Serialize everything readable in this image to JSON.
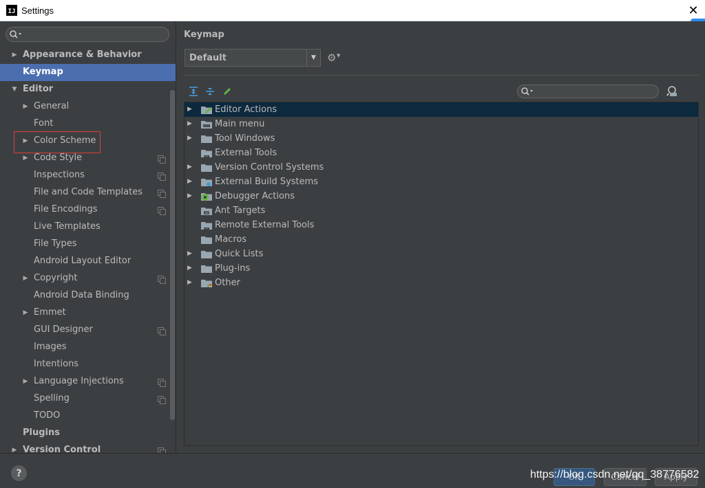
{
  "window": {
    "title": "Settings",
    "app_icon_text": "IJ"
  },
  "sidebar": {
    "search_placeholder": "",
    "items": [
      {
        "label": "Appearance & Behavior",
        "level": 0,
        "arrow": "right",
        "bold": true
      },
      {
        "label": "Keymap",
        "level": 0,
        "arrow": "",
        "bold": true,
        "selected": true
      },
      {
        "label": "Editor",
        "level": 0,
        "arrow": "down",
        "bold": true
      },
      {
        "label": "General",
        "level": 1,
        "arrow": "right"
      },
      {
        "label": "Font",
        "level": 1,
        "arrow": ""
      },
      {
        "label": "Color Scheme",
        "level": 1,
        "arrow": "right",
        "highlighted": true
      },
      {
        "label": "Code Style",
        "level": 1,
        "arrow": "right",
        "project": true
      },
      {
        "label": "Inspections",
        "level": 1,
        "arrow": "",
        "project": true
      },
      {
        "label": "File and Code Templates",
        "level": 1,
        "arrow": "",
        "project": true
      },
      {
        "label": "File Encodings",
        "level": 1,
        "arrow": "",
        "project": true
      },
      {
        "label": "Live Templates",
        "level": 1,
        "arrow": ""
      },
      {
        "label": "File Types",
        "level": 1,
        "arrow": ""
      },
      {
        "label": "Android Layout Editor",
        "level": 1,
        "arrow": ""
      },
      {
        "label": "Copyright",
        "level": 1,
        "arrow": "right",
        "project": true
      },
      {
        "label": "Android Data Binding",
        "level": 1,
        "arrow": ""
      },
      {
        "label": "Emmet",
        "level": 1,
        "arrow": "right"
      },
      {
        "label": "GUI Designer",
        "level": 1,
        "arrow": "",
        "project": true
      },
      {
        "label": "Images",
        "level": 1,
        "arrow": ""
      },
      {
        "label": "Intentions",
        "level": 1,
        "arrow": ""
      },
      {
        "label": "Language Injections",
        "level": 1,
        "arrow": "right",
        "project": true
      },
      {
        "label": "Spelling",
        "level": 1,
        "arrow": "",
        "project": true
      },
      {
        "label": "TODO",
        "level": 1,
        "arrow": ""
      },
      {
        "label": "Plugins",
        "level": 0,
        "arrow": "",
        "bold": true
      },
      {
        "label": "Version Control",
        "level": 0,
        "arrow": "right",
        "bold": true,
        "project": true
      }
    ]
  },
  "main": {
    "title": "Keymap",
    "keymap_value": "Default",
    "filter_placeholder": "",
    "actions": [
      {
        "label": "Editor Actions",
        "arrow": true,
        "selected": true,
        "folder": "edit"
      },
      {
        "label": "Main menu",
        "arrow": true,
        "folder": "menu"
      },
      {
        "label": "Tool Windows",
        "arrow": true,
        "folder": "plain"
      },
      {
        "label": "External Tools",
        "arrow": false,
        "folder": "tools"
      },
      {
        "label": "Version Control Systems",
        "arrow": true,
        "folder": "plain"
      },
      {
        "label": "External Build Systems",
        "arrow": true,
        "folder": "build"
      },
      {
        "label": "Debugger Actions",
        "arrow": true,
        "folder": "bug"
      },
      {
        "label": "Ant Targets",
        "arrow": false,
        "folder": "ant"
      },
      {
        "label": "Remote External Tools",
        "arrow": false,
        "folder": "tools"
      },
      {
        "label": "Macros",
        "arrow": false,
        "folder": "plain"
      },
      {
        "label": "Quick Lists",
        "arrow": true,
        "folder": "plain"
      },
      {
        "label": "Plug-ins",
        "arrow": true,
        "folder": "plain"
      },
      {
        "label": "Other",
        "arrow": true,
        "folder": "other"
      }
    ]
  },
  "footer": {
    "help_label": "?",
    "ok_label": "OK",
    "cancel_label": "Cancel",
    "apply_label": "Apply",
    "watermark": "https://blog.csdn.net/qq_38776582"
  },
  "colors": {
    "background": "#3c3f41",
    "selection": "#4b6eaf",
    "tree_selection": "#0d293e",
    "highlight_box": "#e03d3d"
  }
}
